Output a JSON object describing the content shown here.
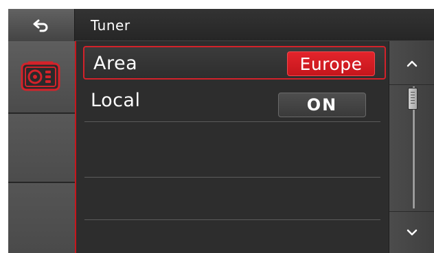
{
  "header": {
    "title": "Tuner",
    "back_icon": "back-arrow-icon"
  },
  "sidebar": {
    "items": [
      {
        "icon": "radio-icon",
        "active": true
      },
      {
        "icon": "",
        "active": false
      },
      {
        "icon": "",
        "active": false
      }
    ]
  },
  "settings": {
    "rows": [
      {
        "label": "Area",
        "value": "Europe",
        "selected": true
      },
      {
        "label": "Local",
        "value": "ON",
        "selected": false
      },
      {
        "label": "",
        "value": ""
      },
      {
        "label": "",
        "value": ""
      }
    ]
  },
  "scrollbar": {
    "up_icon": "chevron-up-icon",
    "down_icon": "chevron-down-icon",
    "position": 0.0
  },
  "colors": {
    "accent": "#d4222a",
    "background": "#2d2d2d",
    "sidebar": "#575757"
  }
}
